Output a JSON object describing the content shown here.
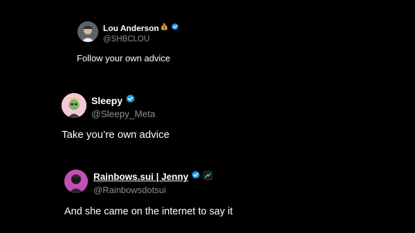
{
  "theme": {
    "background": "#000000",
    "text": "#ffffff",
    "secondary_text": "#8b8f94",
    "verified_blue": "#1d9bf0"
  },
  "tweets": [
    {
      "display_name": "Lou Anderson",
      "handle": "@SHBCLOU",
      "text": "Follow your own advice",
      "badges": [
        "money-bag-icon",
        "verified-badge-icon"
      ]
    },
    {
      "display_name": "Sleepy",
      "handle": "@Sleepy_Meta",
      "text": "Take you’re own advice",
      "badges": [
        "verified-badge-icon"
      ]
    },
    {
      "display_name": "Rainbows.sui | Jenny",
      "handle": "@Rainbowsdotsui",
      "text": "And she came on the internet to say it",
      "badges": [
        "verified-badge-icon",
        "affiliate-badge-icon"
      ]
    }
  ]
}
